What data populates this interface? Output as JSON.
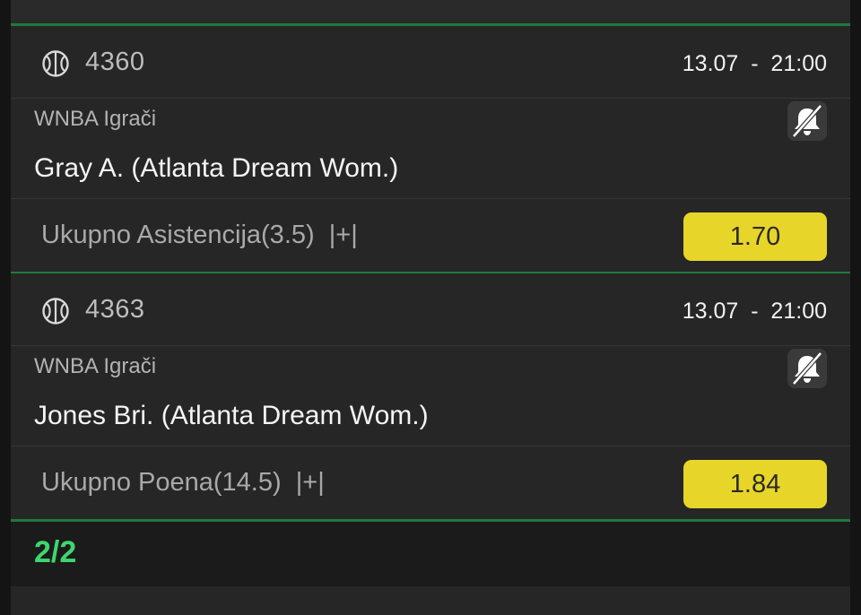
{
  "tickets": [
    {
      "code": "4360",
      "datetime": "13.07  -  21:00",
      "league": "WNBA Igrači",
      "player": "Gray A. (Atlanta Dream Wom.)",
      "market": "Ukupno Asistencija(3.5)  |+|",
      "odd": "1.70"
    },
    {
      "code": "4363",
      "datetime": "13.07  -  21:00",
      "league": "WNBA Igrači",
      "player": "Jones Bri. (Atlanta Dream Wom.)",
      "market": "Ukupno Poena(14.5)  |+|",
      "odd": "1.84"
    }
  ],
  "footer": {
    "count": "2/2"
  },
  "icons": {
    "sport": "basketball-icon",
    "notification": "bell-off-icon"
  },
  "colors": {
    "background": "#262626",
    "divider_green": "#1e7a3a",
    "odd_button": "#e8d529",
    "count_green": "#3fd66d"
  }
}
